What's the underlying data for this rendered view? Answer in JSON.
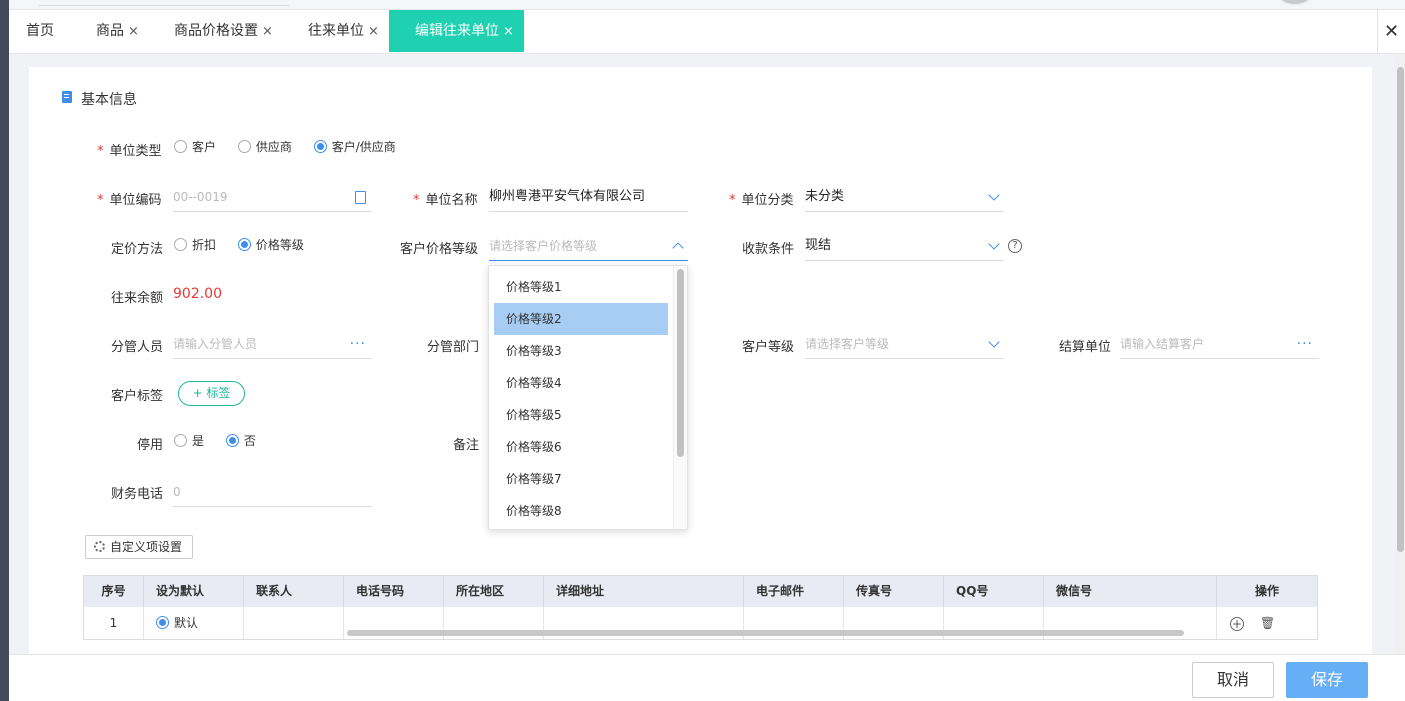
{
  "tabs": [
    {
      "label": "首页",
      "closable": false
    },
    {
      "label": "商品",
      "closable": true
    },
    {
      "label": "商品价格设置",
      "closable": true
    },
    {
      "label": "往来单位",
      "closable": true
    },
    {
      "label": "编辑往来单位",
      "closable": true,
      "active": true
    }
  ],
  "tab_close_glyph": "×",
  "window_close_glyph": "✕",
  "section": {
    "title": "基本信息"
  },
  "form": {
    "unit_type": {
      "label": "单位类型",
      "options": [
        "客户",
        "供应商",
        "客户/供应商"
      ],
      "selected": "客户/供应商"
    },
    "unit_code": {
      "label": "单位编码",
      "value": "",
      "placeholder": "00--0019"
    },
    "unit_name": {
      "label": "单位名称",
      "value": "柳州粤港平安气体有限公司"
    },
    "unit_category": {
      "label": "单位分类",
      "value": "未分类"
    },
    "pricing_method": {
      "label": "定价方法",
      "options": [
        "折扣",
        "价格等级"
      ],
      "selected": "价格等级"
    },
    "customer_price_level": {
      "label": "客户价格等级",
      "value": "",
      "placeholder": "请选择客户价格等级"
    },
    "payment_terms": {
      "label": "收款条件",
      "value": "现结"
    },
    "balance": {
      "label": "往来余额",
      "value": "902.00"
    },
    "manager": {
      "label": "分管人员",
      "value": "",
      "placeholder": "请输入分管人员"
    },
    "department": {
      "label": "分管部门",
      "value": ""
    },
    "customer_level": {
      "label": "客户等级",
      "value": "",
      "placeholder": "请选择客户等级"
    },
    "settlement_unit": {
      "label": "结算单位",
      "value": "",
      "placeholder": "请输入结算客户"
    },
    "customer_tag": {
      "label": "客户标签",
      "button": "+ 标签"
    },
    "disabled": {
      "label": "停用",
      "options": [
        "是",
        "否"
      ],
      "selected": "否"
    },
    "remark": {
      "label": "备注",
      "value": ""
    },
    "finance_phone": {
      "label": "财务电话",
      "value": "",
      "placeholder": "0"
    }
  },
  "dropdown": {
    "items": [
      "价格等级1",
      "价格等级2",
      "价格等级3",
      "价格等级4",
      "价格等级5",
      "价格等级6",
      "价格等级7",
      "价格等级8"
    ],
    "highlighted": "价格等级2"
  },
  "custom_settings_button": "自定义项设置",
  "contacts_table": {
    "columns": [
      "序号",
      "设为默认",
      "联系人",
      "电话号码",
      "所在地区",
      "详细地址",
      "电子邮件",
      "传真号",
      "QQ号",
      "微信号",
      "操作"
    ],
    "rows": [
      {
        "index": "1",
        "default_label": "默认",
        "is_default": true
      }
    ]
  },
  "footer": {
    "cancel": "取消",
    "save": "保存"
  },
  "colors": {
    "accent": "#1fd1b1",
    "primary": "#3f8ee8",
    "danger": "#e53935",
    "save_button": "#66aef5"
  }
}
